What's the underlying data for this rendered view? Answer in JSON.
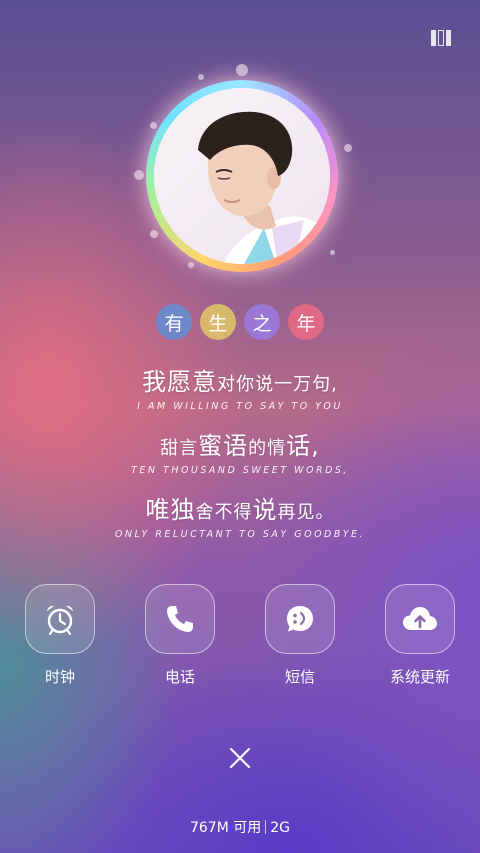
{
  "badges": [
    {
      "char": "有",
      "color": "#6f88c9"
    },
    {
      "char": "生",
      "color": "#d8b86a"
    },
    {
      "char": "之",
      "color": "#9b78d6"
    },
    {
      "char": "年",
      "color": "#e06a86"
    }
  ],
  "poem": {
    "line1": {
      "big": "我愿意",
      "small": "对你说一万句,",
      "en": "I AM WILLING TO SAY TO YOU"
    },
    "line2": {
      "p1": "甜言",
      "big1": "蜜语",
      "p2": "的情",
      "big2": "话,",
      "en": "TEN THOUSAND SWEET WORDS,"
    },
    "line3": {
      "big1": "唯独",
      "p1": "舍不得",
      "big2": "说",
      "p2": "再见。",
      "en": "ONLY RELUCTANT TO SAY GOODBYE."
    }
  },
  "apps": [
    {
      "label": "时钟",
      "icon": "alarm-clock-icon"
    },
    {
      "label": "电话",
      "icon": "phone-icon"
    },
    {
      "label": "短信",
      "icon": "message-icon"
    },
    {
      "label": "系统更新",
      "icon": "cloud-upload-icon"
    }
  ],
  "footer": {
    "memory": "767M 可用",
    "network": "2G"
  }
}
